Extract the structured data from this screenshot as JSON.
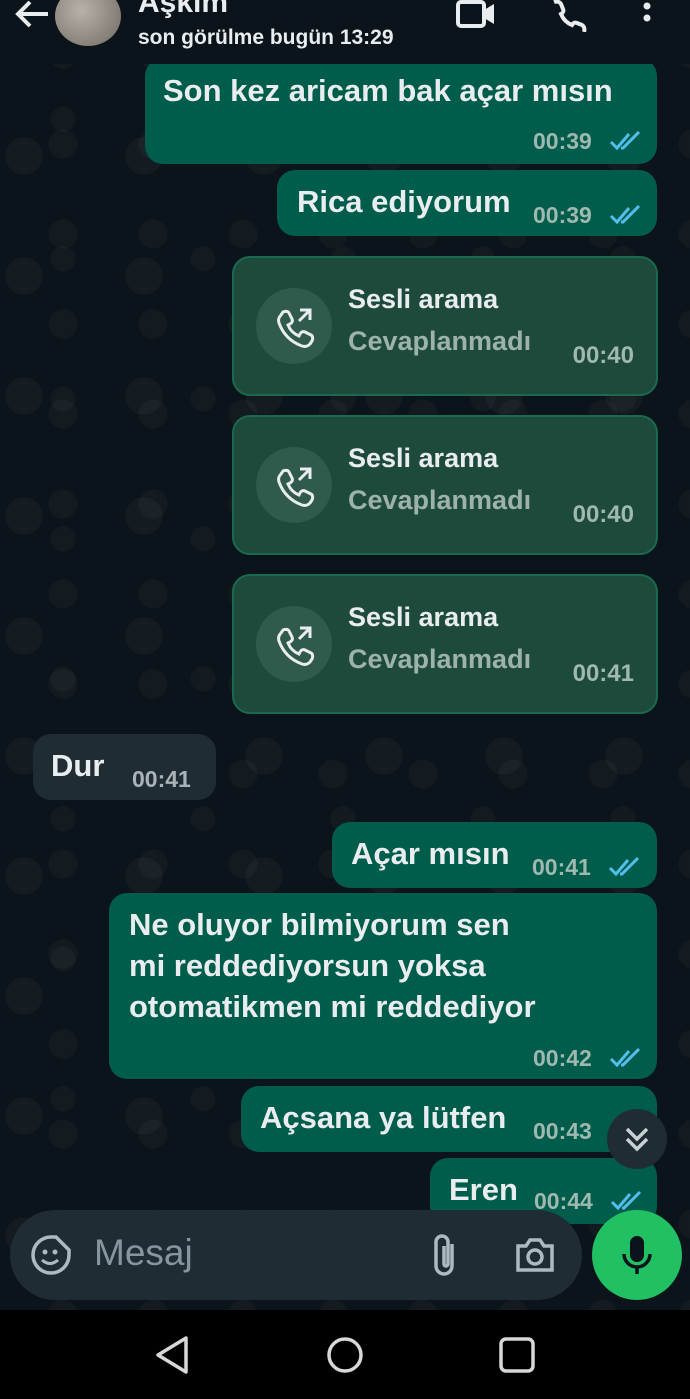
{
  "header": {
    "contact_name": "Aşkım",
    "last_seen": "son görülme bugün 13:29",
    "icons": [
      "back-arrow-icon",
      "video-call-icon",
      "voice-call-icon",
      "more-vertical-icon"
    ]
  },
  "messages": [
    {
      "type": "out",
      "text": "Son kez aricam bak açar mısın",
      "time": "00:39",
      "status": "read"
    },
    {
      "type": "out",
      "text": "Rica ediyorum",
      "time": "00:39",
      "status": "read"
    },
    {
      "type": "call",
      "title": "Sesli arama",
      "subtitle": "Cevaplanmadı",
      "time": "00:40"
    },
    {
      "type": "call",
      "title": "Sesli arama",
      "subtitle": "Cevaplanmadı",
      "time": "00:40"
    },
    {
      "type": "call",
      "title": "Sesli arama",
      "subtitle": "Cevaplanmadı",
      "time": "00:41"
    },
    {
      "type": "in",
      "text": "Dur",
      "time": "00:41"
    },
    {
      "type": "out",
      "text": "Açar mısın",
      "time": "00:41",
      "status": "read"
    },
    {
      "type": "out",
      "lines": [
        "Ne oluyor bilmiyorum sen",
        "mi reddediyorsun yoksa",
        "otomatikmen mi reddediyor"
      ],
      "time": "00:42",
      "status": "read"
    },
    {
      "type": "out",
      "text": "Açsana ya lütfen",
      "time": "00:43",
      "status": "read"
    },
    {
      "type": "out",
      "text": "Eren",
      "time": "00:44",
      "status": "read"
    }
  ],
  "composer": {
    "placeholder": "Mesaj",
    "icons": [
      "sticker-icon",
      "attach-icon",
      "camera-icon",
      "mic-icon"
    ]
  },
  "colors": {
    "outgoing_bubble": "#005c4b",
    "incoming_bubble": "#202c33",
    "read_ticks": "#53bdeb",
    "mic_button": "#21c063"
  }
}
